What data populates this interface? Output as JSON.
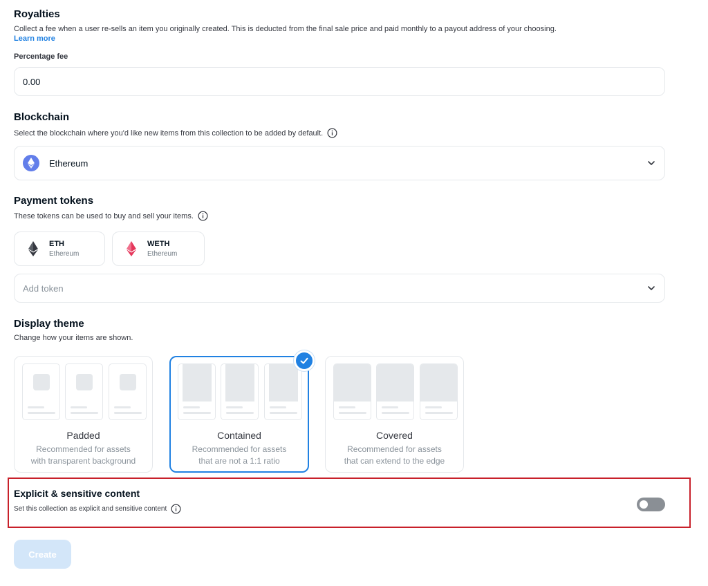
{
  "royalties": {
    "title": "Royalties",
    "description": "Collect a fee when a user re-sells an item you originally created. This is deducted from the final sale price and paid monthly to a payout address of your choosing.",
    "learn_more": "Learn more",
    "percentage_label": "Percentage fee",
    "percentage_value": "0.00"
  },
  "blockchain": {
    "title": "Blockchain",
    "description": "Select the blockchain where you'd like new items from this collection to be added by default.",
    "selected": "Ethereum"
  },
  "payment_tokens": {
    "title": "Payment tokens",
    "description": "These tokens can be used to buy and sell your items.",
    "tokens": [
      {
        "symbol": "ETH",
        "network": "Ethereum",
        "icon": "eth-icon",
        "color": "#353840"
      },
      {
        "symbol": "WETH",
        "network": "Ethereum",
        "icon": "weth-icon",
        "color": "#e5375b"
      }
    ],
    "add_token_placeholder": "Add token"
  },
  "display_theme": {
    "title": "Display theme",
    "description": "Change how your items are shown.",
    "options": [
      {
        "name": "Padded",
        "desc1": "Recommended for assets",
        "desc2": "with transparent background",
        "selected": false
      },
      {
        "name": "Contained",
        "desc1": "Recommended for assets",
        "desc2": "that are not a 1:1 ratio",
        "selected": true
      },
      {
        "name": "Covered",
        "desc1": "Recommended for assets",
        "desc2": "that can extend to the edge",
        "selected": false
      }
    ]
  },
  "explicit": {
    "title": "Explicit & sensitive content",
    "description": "Set this collection as explicit and sensitive content",
    "enabled": false
  },
  "create_label": "Create",
  "colors": {
    "accent": "#2081e2",
    "highlight": "#c8202a",
    "ethereum": "#627eea"
  }
}
